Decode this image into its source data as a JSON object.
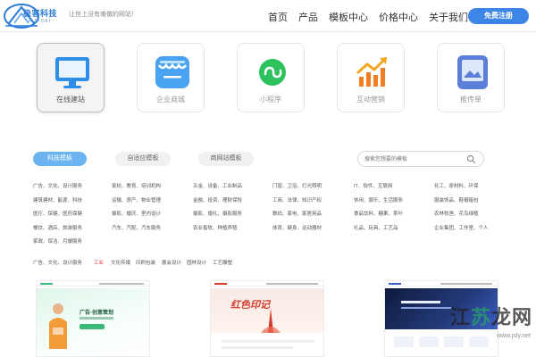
{
  "header": {
    "brand_name": "极客科技",
    "brand_sub": "F.JYOKI",
    "slogan": "让世上没有难做的网站！",
    "nav": [
      "首页",
      "产品",
      "模板中心",
      "价格中心",
      "关于我们"
    ],
    "cta_label": "免费注册"
  },
  "categories": [
    {
      "label": "在线建站",
      "icon": "monitor-icon",
      "active": true
    },
    {
      "label": "企业商城",
      "icon": "storefront-icon",
      "active": false
    },
    {
      "label": "小程序",
      "icon": "mini-program-icon",
      "active": false
    },
    {
      "label": "互动营销",
      "icon": "growth-chart-icon",
      "active": false
    },
    {
      "label": "推传单",
      "icon": "flyer-icon",
      "active": false
    }
  ],
  "filter": {
    "tabs": [
      "科技模板",
      "自适应模板",
      "商网站模板"
    ],
    "search_placeholder": "搜索您想要的模板"
  },
  "links": [
    [
      "广告、文化、设计服务",
      "家纺、教育、培训机构",
      "五金、设备、工业制品",
      "门窗、卫浴、灯光照明",
      "IT、软件、互联网",
      "化工、原材料、环保"
    ],
    [
      "建筑建材、能源、科技",
      "运输、房产、物业管理",
      "金融、投资、理财保险",
      "工商、法律、知识产权",
      "休闲、娱乐、生活服务",
      "服装饰品、鞋帽箱包"
    ],
    [
      "医疗、保健、医药保健",
      "摄影、婚庆、室内设计",
      "摄影、婚礼、摄影服务",
      "数码、家电、家居用品",
      "食品饮料、糖果、茶叶",
      "农林牧渔、花鸟绿植"
    ],
    [
      "餐饮、酒店、旅游服务",
      "汽车、汽配、汽车服务",
      "农业畜牧、种植养殖",
      "体育、健身、运动器材",
      "礼品、玩具、工艺品",
      "企业集团、工作室、个人"
    ],
    [
      "家政、保洁、月嫂服务"
    ]
  ],
  "tags": [
    {
      "label": "广告、文化、设计服务",
      "hot": false
    },
    {
      "label": "工业",
      "hot": true
    },
    {
      "label": "文化传媒",
      "hot": false
    },
    {
      "label": "印刷包装",
      "hot": false
    },
    {
      "label": "展会设计",
      "hot": false
    },
    {
      "label": "园林设计",
      "hot": false
    },
    {
      "label": "工艺雕塑",
      "hot": false
    }
  ],
  "thumbnails": [
    {
      "headline": "广告·创意策划"
    },
    {
      "headline": "红色印记"
    },
    {
      "headline": ""
    }
  ],
  "watermark": {
    "main": "江苏龙网",
    "accent": "苏",
    "url": "www.jsly.net"
  },
  "colors": {
    "accent": "#3d86e8",
    "tab_active": "#6cb4f0",
    "hot_tag": "#e0312b"
  }
}
